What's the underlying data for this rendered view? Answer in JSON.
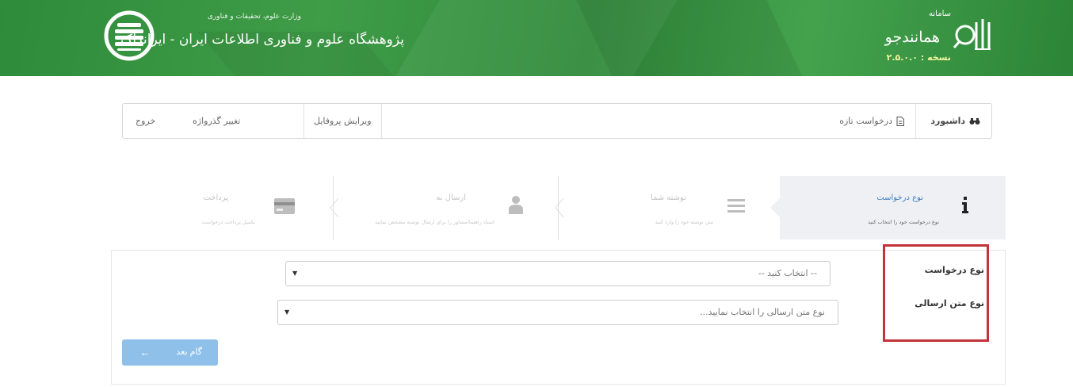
{
  "header": {
    "irandoc_subtitle": "وزارت علوم، تحقیقات و فناوری",
    "irandoc_name": "پژوهشگاه علوم و فناوری اطلاعات ایران  -  ایرانداک",
    "system_label": "سامانه",
    "system_name": "همانندجو",
    "version": "نسخه : ۲.۵.۰.۰",
    "colors": {
      "primary": "#3a9442",
      "version_text": "#f4f4a0"
    }
  },
  "navbar": {
    "dashboard": "داشبورد",
    "new_request": "درخواست تازه",
    "edit_profile": "ویرایش پروفایل",
    "change_password": "تغییر گذرواژه",
    "logout": "خروج"
  },
  "steps": [
    {
      "title": "نوع درخواست",
      "desc": "نوع درخواست خود را انتخاب کنید",
      "icon": "info-icon",
      "active": true
    },
    {
      "title": "نوشته شما",
      "desc": "متن نوشته خود را وارد کنید",
      "icon": "text-lines-icon",
      "active": false
    },
    {
      "title": "ارسال به",
      "desc": "استاد راهنما/مشاور را برای ارسال نوشته مشخص نمایید",
      "icon": "user-icon",
      "active": false
    },
    {
      "title": "پرداخت",
      "desc": "تکمیل پرداخت درخواست",
      "icon": "credit-card-icon",
      "active": false
    }
  ],
  "form": {
    "request_type_label": "نوع درخواست",
    "request_type_value": "-- انتخاب کنید --",
    "text_type_label": "نوع متن ارسالی",
    "text_type_placeholder": "نوع متن ارسالی را انتخاب نمایید...",
    "next_button": "گام بعد",
    "highlight_color": "#c0343a",
    "button_color": "#8ec0ea"
  }
}
